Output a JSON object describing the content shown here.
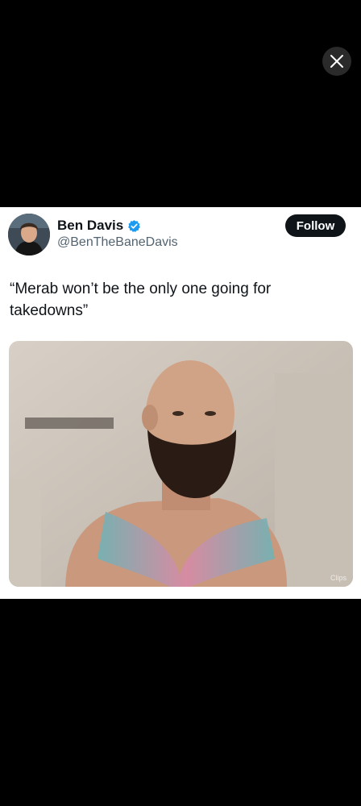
{
  "overlay": {
    "close_icon": "close-icon"
  },
  "tweet": {
    "author_name": "Ben Davis",
    "verified_icon": "verified-badge-icon",
    "handle": "@BenTheBaneDavis",
    "follow_label": "Follow",
    "text": "“Merab won’t be the only one going for takedowns”",
    "media_watermark": "Clips"
  },
  "colors": {
    "background": "#000000",
    "card": "#ffffff",
    "text_primary": "#0f1419",
    "text_secondary": "#536471",
    "verified": "#1d9bf0",
    "follow_button": "#0f1419"
  }
}
